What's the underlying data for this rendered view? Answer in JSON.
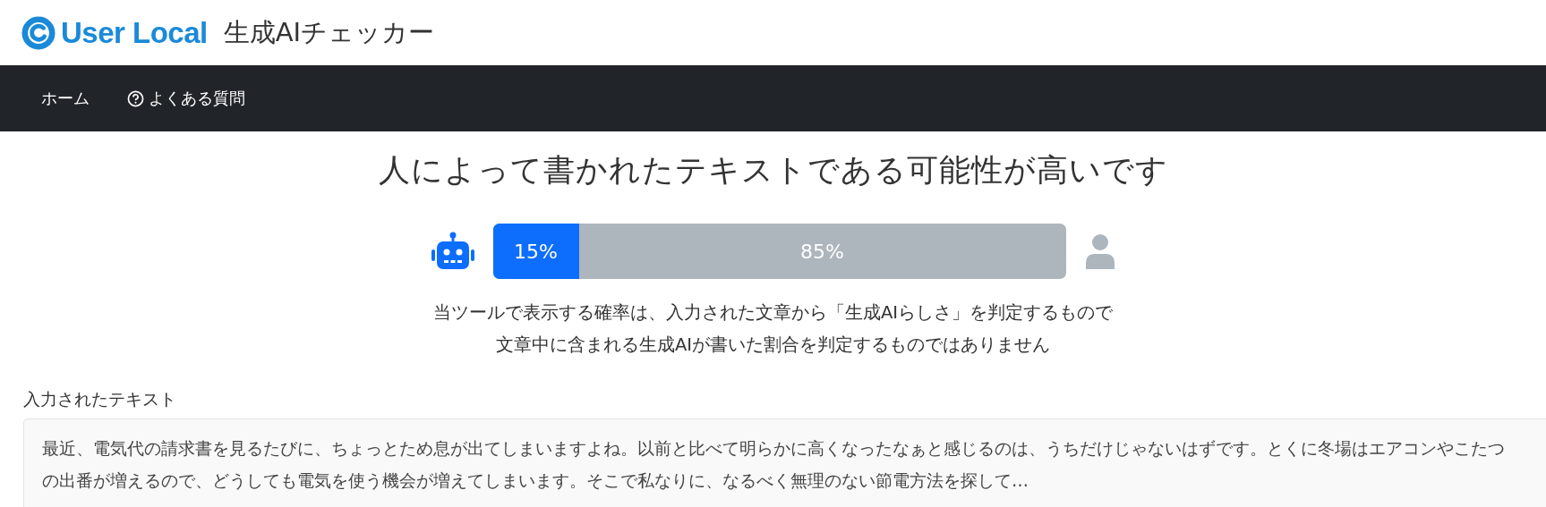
{
  "header": {
    "brand": "User Local",
    "product": "生成AIチェッカー"
  },
  "nav": [
    {
      "label": "ホーム",
      "icon": false
    },
    {
      "label": "よくある質問",
      "icon": true
    }
  ],
  "result": {
    "title": "人によって書かれたテキストである可能性が高いです",
    "ai": {
      "text": "15%",
      "level": 0.15
    },
    "human": {
      "text": "85%"
    },
    "notes": [
      "当ツールで表示する確率は、入力された文章から「生成AIらしさ」を判定するもので",
      "文章中に含まれる生成AIが書いた割合を判定するものではありません"
    ]
  },
  "input": {
    "label": "入力されたテキスト",
    "text": "最近、電気代の請求書を見るたびに、ちょっとため息が出てしまいますよね。以前と比べて明らかに高くなったなぁと感じるのは、うちだけじゃないはずです。とくに冬場はエアコンやこたつの出番が増えるので、どうしても電気を使う機会が増えてしまいます。そこで私なりに、なるべく無理のない節電方法を探して…"
  }
}
